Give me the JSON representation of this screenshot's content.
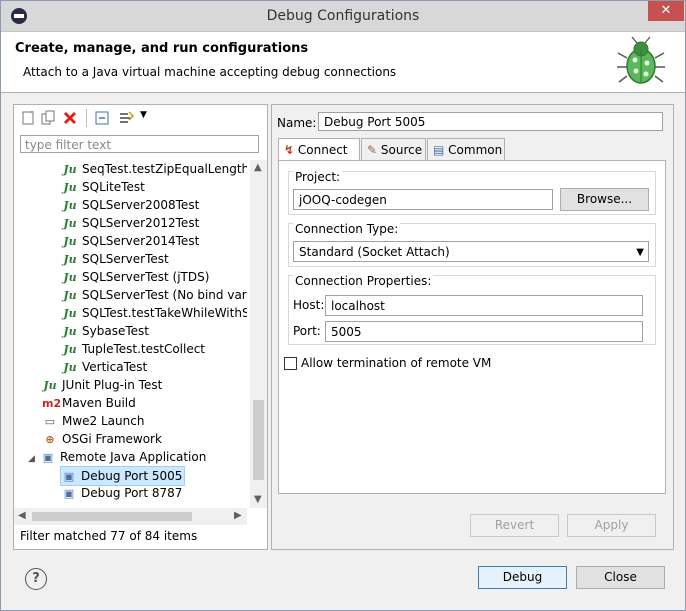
{
  "window": {
    "title": "Debug Configurations",
    "close_glyph": "✕"
  },
  "banner": {
    "heading": "Create, manage, and run configurations",
    "description": "Attach to a Java virtual machine accepting debug connections"
  },
  "left": {
    "filter_placeholder": "type filter text",
    "tree": [
      {
        "icon": "junit-icon",
        "glyph": "Ju",
        "label": "SeqTest.testZipEqualLength"
      },
      {
        "icon": "junit-icon",
        "glyph": "Ju",
        "label": "SQLiteTest"
      },
      {
        "icon": "junit-icon",
        "glyph": "Ju",
        "label": "SQLServer2008Test"
      },
      {
        "icon": "junit-icon",
        "glyph": "Ju",
        "label": "SQLServer2012Test"
      },
      {
        "icon": "junit-icon",
        "glyph": "Ju",
        "label": "SQLServer2014Test"
      },
      {
        "icon": "junit-icon",
        "glyph": "Ju",
        "label": "SQLServerTest"
      },
      {
        "icon": "junit-icon",
        "glyph": "Ju",
        "label": "SQLServerTest (jTDS)"
      },
      {
        "icon": "junit-icon",
        "glyph": "Ju",
        "label": "SQLServerTest (No bind variabl"
      },
      {
        "icon": "junit-icon",
        "glyph": "Ju",
        "label": "SQLTest.testTakeWhileWithSQL"
      },
      {
        "icon": "junit-icon",
        "glyph": "Ju",
        "label": "SybaseTest"
      },
      {
        "icon": "junit-icon",
        "glyph": "Ju",
        "label": "TupleTest.testCollect"
      },
      {
        "icon": "junit-icon",
        "glyph": "Ju",
        "label": "VerticaTest"
      },
      {
        "icon": "junit-plugin-icon",
        "glyph": "Ju",
        "label": "JUnit Plug-in Test"
      },
      {
        "icon": "maven-icon",
        "glyph": "m2",
        "label": "Maven Build"
      },
      {
        "icon": "mwe2-icon",
        "glyph": "▭",
        "label": "Mwe2 Launch"
      },
      {
        "icon": "osgi-icon",
        "glyph": "⊕",
        "label": "OSGi Framework"
      },
      {
        "icon": "remote-java-icon",
        "glyph": "▣",
        "label": "Remote Java Application"
      },
      {
        "icon": "debug-port-icon",
        "glyph": "▣",
        "label": "Debug Port 5005"
      },
      {
        "icon": "debug-port-icon",
        "glyph": "▣",
        "label": "Debug Port 8787"
      }
    ],
    "status": "Filter matched 77 of 84 items"
  },
  "right": {
    "name_label": "Name:",
    "name_value": "Debug Port 5005",
    "tabs": [
      {
        "label": "Connect",
        "icon": "connect-icon"
      },
      {
        "label": "Source",
        "icon": "source-icon"
      },
      {
        "label": "Common",
        "icon": "common-icon"
      }
    ],
    "project_label": "Project:",
    "project_value": "jOOQ-codegen",
    "browse_label": "Browse...",
    "connection_type_label": "Connection Type:",
    "connection_type_value": "Standard (Socket Attach)",
    "connection_props_label": "Connection Properties:",
    "host_label": "Host:",
    "host_value": "localhost",
    "port_label": "Port:",
    "port_value": "5005",
    "allow_termination_label": "Allow termination of remote VM",
    "allow_termination_checked": false,
    "revert_label": "Revert",
    "apply_label": "Apply"
  },
  "footer": {
    "help_glyph": "?",
    "debug_label": "Debug",
    "close_label": "Close"
  },
  "colors": {
    "junit_green": "#2e7d32",
    "selection": "#cce8ff",
    "close_red": "#c75050"
  }
}
